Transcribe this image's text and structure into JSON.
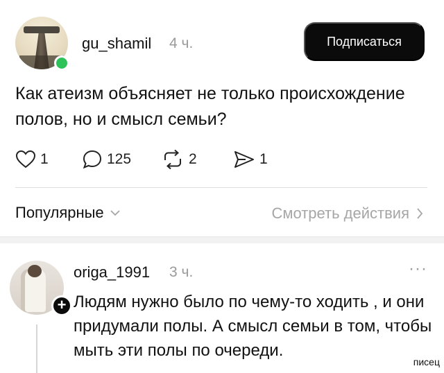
{
  "post": {
    "username": "gu_shamil",
    "time": "4 ч.",
    "subscribe_label": "Подписаться",
    "text": "Как атеизм объясняет не только происхождение полов, но и смысл семьи?",
    "actions": {
      "likes": "1",
      "comments": "125",
      "reposts": "2",
      "shares": "1"
    }
  },
  "sort": {
    "label": "Популярные",
    "view_actions": "Смотреть действия"
  },
  "comment": {
    "username": "origa_1991",
    "time": "3 ч.",
    "more": "···",
    "text": "Людям нужно было по чему-то ходить , и они придумали полы. А смысл семьи в том, чтобы мыть эти полы по очереди."
  },
  "watermark": "писец",
  "icons": {
    "like": "heart-icon",
    "comment": "speech-bubble-icon",
    "repost": "repost-arrows-icon",
    "share": "send-icon",
    "sort_chevron": "chevron-down-icon",
    "view_chevron": "chevron-right-icon",
    "plus": "plus-icon"
  },
  "colors": {
    "online": "#2ec25a",
    "button_bg": "#0b0b0b",
    "muted_text": "#9a9a9a"
  }
}
